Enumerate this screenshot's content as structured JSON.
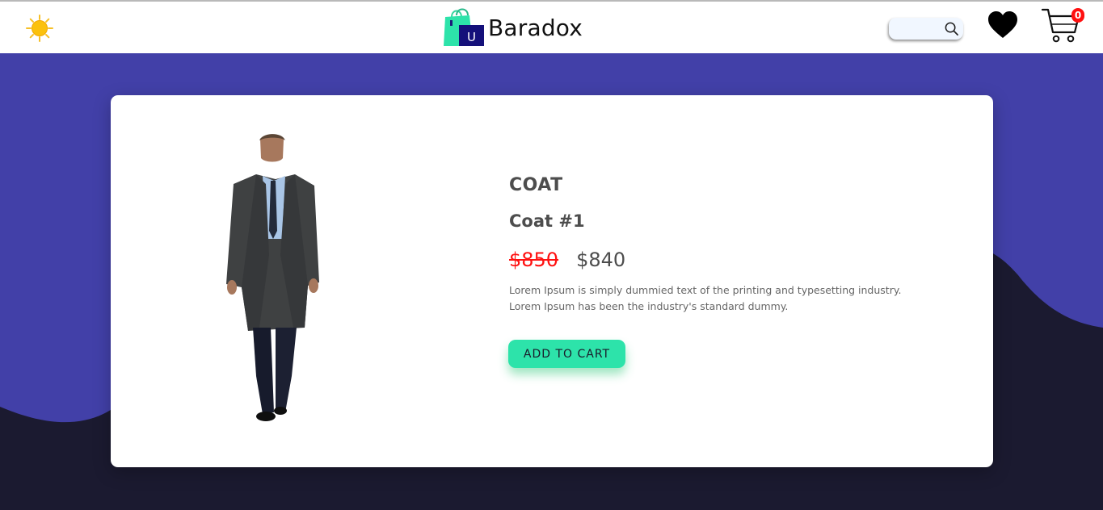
{
  "header": {
    "theme_icon": "sun-icon",
    "brand": {
      "logo_icon": "shopping-bag-icon",
      "logo_letter": "U",
      "name": "Baradox"
    },
    "search": {
      "placeholder": "",
      "value": "",
      "icon": "search-icon"
    },
    "wishlist_icon": "heart-icon",
    "cart": {
      "icon": "cart-icon",
      "count": "0"
    }
  },
  "product": {
    "category": "COAT",
    "name": "Coat #1",
    "old_price": "$850",
    "new_price": "$840",
    "description": "Lorem Ipsum is simply dummied text of the printing and typesetting industry. Lorem Ipsum has been the industry's standard dummy.",
    "add_to_cart_label": "ADD TO CART"
  },
  "colors": {
    "accent": "#2de3aa",
    "hero": "#4240a8",
    "dark_background": "#1b1a30",
    "old_price": "#ff1111",
    "badge": "#ff1010"
  }
}
